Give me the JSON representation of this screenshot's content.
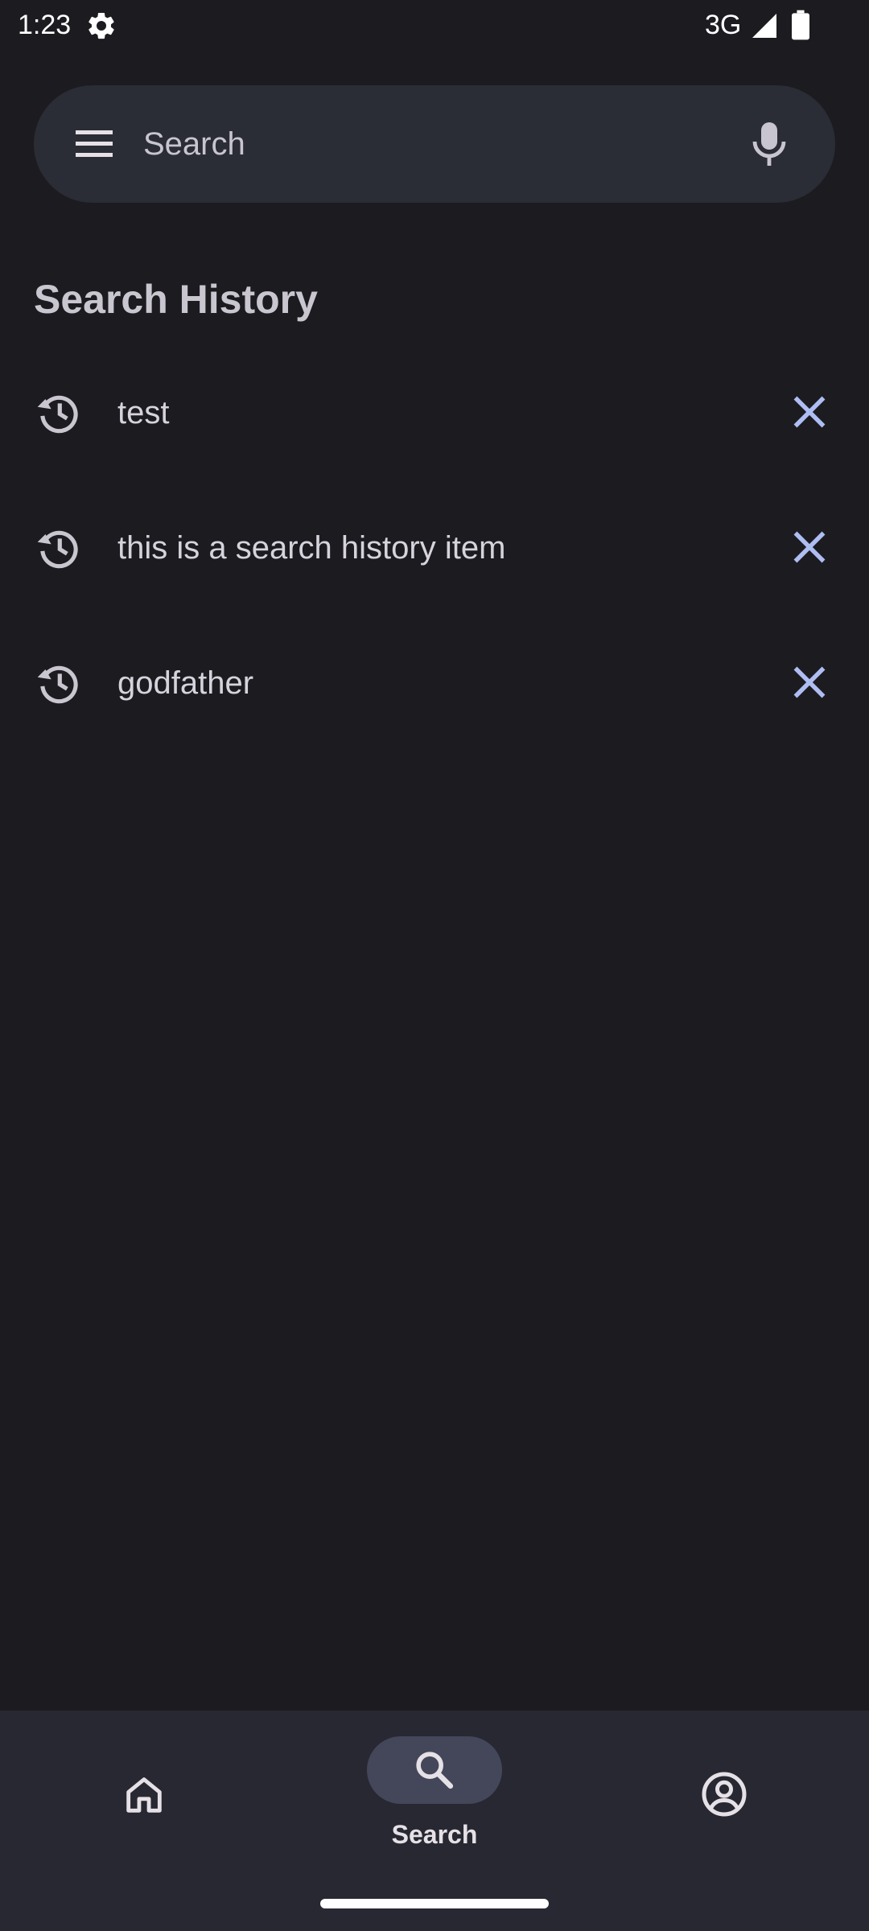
{
  "status_bar": {
    "time": "1:23",
    "network": "3G",
    "icons": [
      "gear-icon",
      "signal-icon",
      "battery-icon"
    ]
  },
  "search": {
    "placeholder": "Search",
    "icons": [
      "menu-icon",
      "mic-icon"
    ]
  },
  "history": {
    "title": "Search History",
    "items": [
      {
        "label": "test"
      },
      {
        "label": "this is a search history item"
      },
      {
        "label": "godfather"
      }
    ],
    "icons": [
      "history-icon",
      "close-icon"
    ]
  },
  "bottom_nav": {
    "items": [
      {
        "icon": "home-icon",
        "label": ""
      },
      {
        "icon": "search-icon",
        "label": "Search",
        "selected": true
      },
      {
        "icon": "account-icon",
        "label": ""
      }
    ]
  },
  "colors": {
    "background": "#1c1b20",
    "search_bar": "#2a2c36",
    "accent": "#aebdf2",
    "nav_background": "#272832",
    "nav_pill": "#44465a"
  }
}
